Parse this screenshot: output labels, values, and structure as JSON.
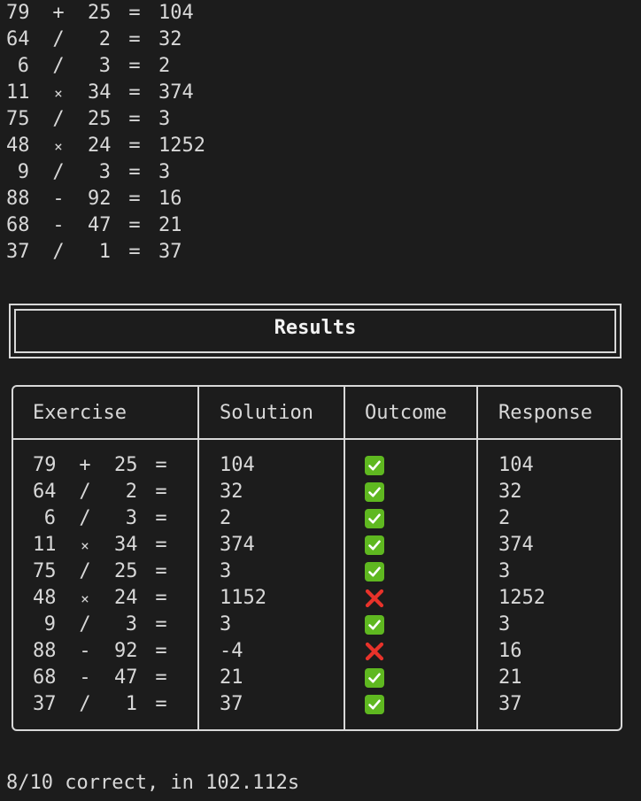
{
  "history": [
    {
      "a": "79",
      "op": "+",
      "b": "25",
      "eq": "=",
      "ans": "104"
    },
    {
      "a": "64",
      "op": "/",
      "b": "2",
      "eq": "=",
      "ans": "32"
    },
    {
      "a": "6",
      "op": "/",
      "b": "3",
      "eq": "=",
      "ans": "2"
    },
    {
      "a": "11",
      "op": "×",
      "b": "34",
      "eq": "=",
      "ans": "374"
    },
    {
      "a": "75",
      "op": "/",
      "b": "25",
      "eq": "=",
      "ans": "3"
    },
    {
      "a": "48",
      "op": "×",
      "b": "24",
      "eq": "=",
      "ans": "1252"
    },
    {
      "a": "9",
      "op": "/",
      "b": "3",
      "eq": "=",
      "ans": "3"
    },
    {
      "a": "88",
      "op": "-",
      "b": "92",
      "eq": "=",
      "ans": "16"
    },
    {
      "a": "68",
      "op": "-",
      "b": "47",
      "eq": "=",
      "ans": "21"
    },
    {
      "a": "37",
      "op": "/",
      "b": "1",
      "eq": "=",
      "ans": "37"
    }
  ],
  "results": {
    "title": "Results",
    "headers": {
      "exercise": "Exercise",
      "solution": "Solution",
      "outcome": "Outcome",
      "response": "Response"
    },
    "rows": [
      {
        "a": "79",
        "op": "+",
        "b": "25",
        "eq": "=",
        "solution": "104",
        "outcome": "check-mark-icon",
        "response": "104"
      },
      {
        "a": "64",
        "op": "/",
        "b": "2",
        "eq": "=",
        "solution": "32",
        "outcome": "check-mark-icon",
        "response": "32"
      },
      {
        "a": "6",
        "op": "/",
        "b": "3",
        "eq": "=",
        "solution": "2",
        "outcome": "check-mark-icon",
        "response": "2"
      },
      {
        "a": "11",
        "op": "×",
        "b": "34",
        "eq": "=",
        "solution": "374",
        "outcome": "check-mark-icon",
        "response": "374"
      },
      {
        "a": "75",
        "op": "/",
        "b": "25",
        "eq": "=",
        "solution": "3",
        "outcome": "check-mark-icon",
        "response": "3"
      },
      {
        "a": "48",
        "op": "×",
        "b": "24",
        "eq": "=",
        "solution": "1152",
        "outcome": "cross-mark-icon",
        "response": "1252"
      },
      {
        "a": "9",
        "op": "/",
        "b": "3",
        "eq": "=",
        "solution": "3",
        "outcome": "check-mark-icon",
        "response": "3"
      },
      {
        "a": "88",
        "op": "-",
        "b": "92",
        "eq": "=",
        "solution": "-4",
        "outcome": "cross-mark-icon",
        "response": "16"
      },
      {
        "a": "68",
        "op": "-",
        "b": "47",
        "eq": "=",
        "solution": "21",
        "outcome": "check-mark-icon",
        "response": "21"
      },
      {
        "a": "37",
        "op": "/",
        "b": "1",
        "eq": "=",
        "solution": "37",
        "outcome": "check-mark-icon",
        "response": "37"
      }
    ]
  },
  "summary": "8/10 correct, in 102.112s",
  "colors": {
    "background": "#1c1c1c",
    "text": "#d8d8d8",
    "correct": "#5fb820",
    "incorrect": "#e8322a"
  }
}
